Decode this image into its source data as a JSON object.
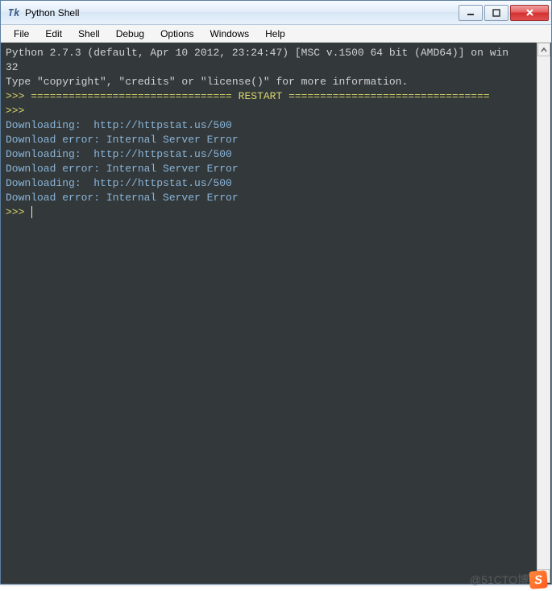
{
  "window": {
    "title": "Python Shell",
    "icon_glyph": "Tk"
  },
  "menu": {
    "items": [
      "File",
      "Edit",
      "Shell",
      "Debug",
      "Options",
      "Windows",
      "Help"
    ]
  },
  "terminal": {
    "banner_line1": "Python 2.7.3 (default, Apr 10 2012, 23:24:47) [MSC v.1500 64 bit (AMD64)] on win",
    "banner_line2": "32",
    "banner_line3": "Type \"copyright\", \"credits\" or \"license()\" for more information.",
    "prompt": ">>>",
    "restart_line": "================================ RESTART ================================",
    "lines": [
      "Downloading:  http://httpstat.us/500",
      "Download error: Internal Server Error",
      "Downloading:  http://httpstat.us/500",
      "Download error: Internal Server Error",
      "Downloading:  http://httpstat.us/500",
      "Download error: Internal Server Error"
    ]
  },
  "watermark": {
    "text": "@51CTO博",
    "badge": "S"
  }
}
